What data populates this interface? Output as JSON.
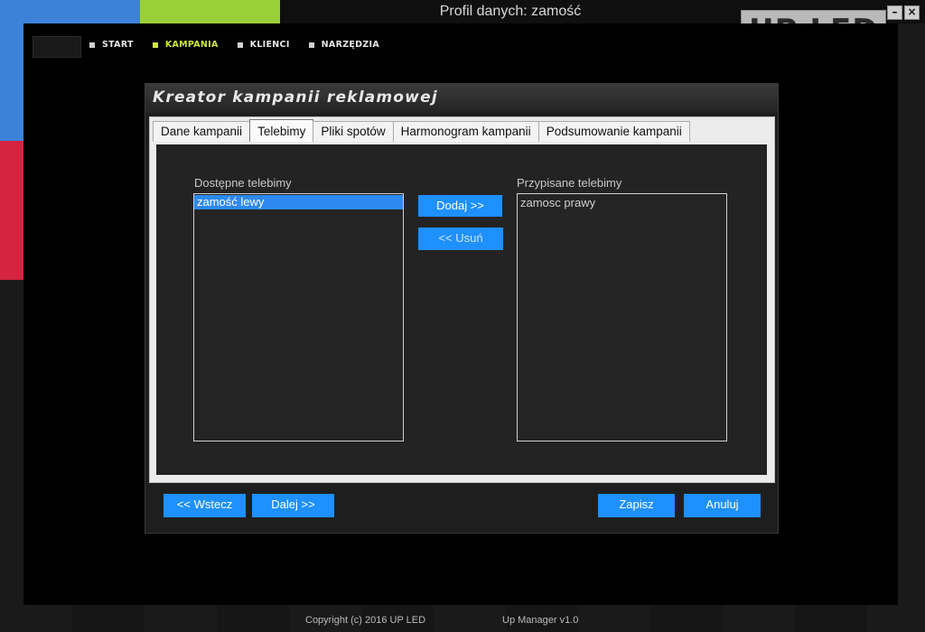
{
  "window": {
    "title": "Profil danych: zamość"
  },
  "logo": {
    "text": "UP LED"
  },
  "nav": {
    "items": [
      {
        "label": "START"
      },
      {
        "label": "KAMPANIA"
      },
      {
        "label": "KLIENCI"
      },
      {
        "label": "NARZĘDZIA"
      }
    ],
    "active_color": "#cde832"
  },
  "dialog": {
    "title": "Kreator kampanii reklamowej",
    "tabs": [
      {
        "label": "Dane kampanii"
      },
      {
        "label": "Telebimy"
      },
      {
        "label": "Pliki spotów"
      },
      {
        "label": "Harmonogram kampanii"
      },
      {
        "label": "Podsumowanie kampanii"
      }
    ],
    "available": {
      "label": "Dostępne telebimy",
      "items": [
        "zamość lewy"
      ]
    },
    "assigned": {
      "label": "Przypisane telebimy",
      "items": [
        "zamosc prawy"
      ]
    },
    "buttons": {
      "add": "Dodaj >>",
      "remove": "<< Usuń",
      "back": "<< Wstecz",
      "next": "Dalej >>",
      "save": "Zapisz",
      "cancel": "Anuluj"
    }
  },
  "footer": {
    "copyright": "Copyright (c) 2016 UP LED",
    "version": "Up Manager v1.0"
  },
  "colors": {
    "accent": "#1e90ff",
    "selection": "#2d89ef"
  }
}
